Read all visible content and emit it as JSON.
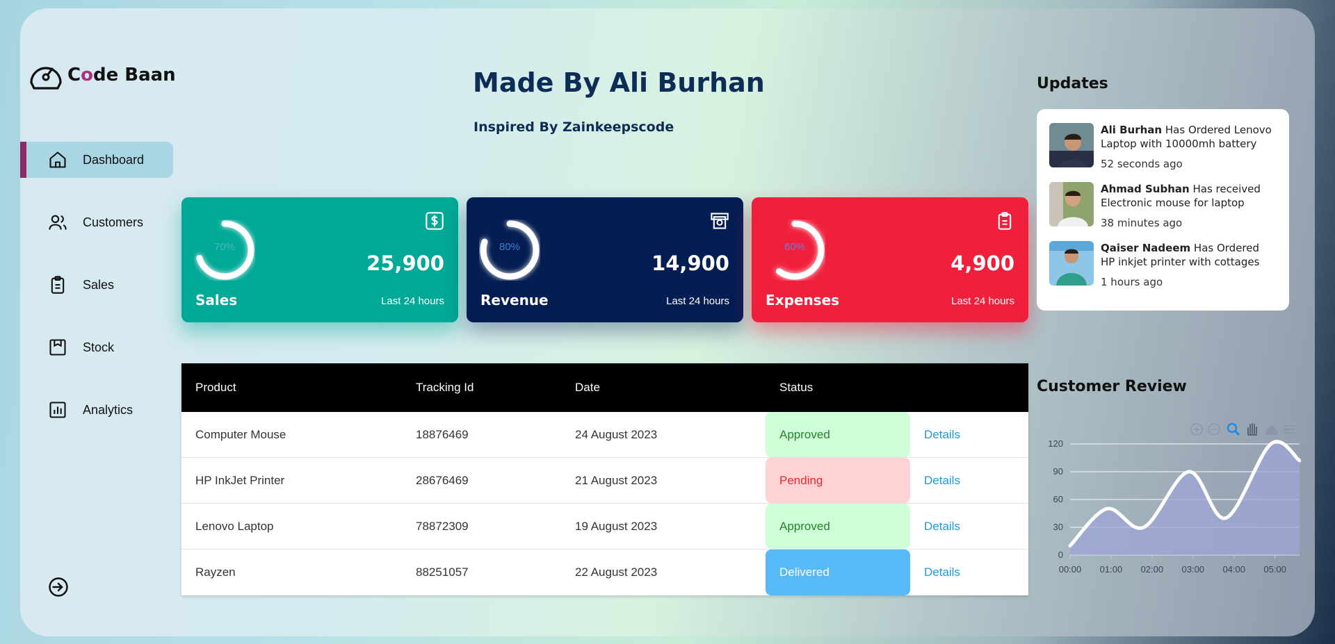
{
  "brand": {
    "prefix": "C",
    "accent": "o",
    "rest": "de Baan"
  },
  "sidebar": {
    "items": [
      {
        "label": "Dashboard",
        "icon": "home-icon",
        "active": true
      },
      {
        "label": "Customers",
        "icon": "users-icon",
        "active": false
      },
      {
        "label": "Sales",
        "icon": "clipboard-icon",
        "active": false
      },
      {
        "label": "Stock",
        "icon": "package-icon",
        "active": false
      },
      {
        "label": "Analytics",
        "icon": "bar-chart-icon",
        "active": false
      }
    ],
    "logout_icon": "logout-icon"
  },
  "header": {
    "title": "Made By Ali Burhan",
    "subtitle": "Inspired By Zainkeepscode"
  },
  "cards": [
    {
      "name": "Sales",
      "value": "25,900",
      "percent": "70%",
      "progress": 70,
      "time": "Last 24 hours",
      "icon": "dollar-icon",
      "color": "#00a896"
    },
    {
      "name": "Revenue",
      "value": "14,900",
      "percent": "80%",
      "progress": 80,
      "time": "Last 24 hours",
      "icon": "money-icon",
      "color": "#041d52"
    },
    {
      "name": "Expenses",
      "value": "4,900",
      "percent": "60%",
      "progress": 60,
      "time": "Last 24 hours",
      "icon": "clipboard-icon",
      "color": "#f0203d"
    }
  ],
  "table": {
    "headers": [
      "Product",
      "Tracking Id",
      "Date",
      "Status"
    ],
    "rows": [
      {
        "product": "Computer Mouse",
        "tracking": "18876469",
        "date": "24 August 2023",
        "status": "Approved",
        "action": "Details"
      },
      {
        "product": "HP InkJet Printer",
        "tracking": "28676469",
        "date": "21 August 2023",
        "status": "Pending",
        "action": "Details"
      },
      {
        "product": "Lenovo Laptop",
        "tracking": "78872309",
        "date": "19 August 2023",
        "status": "Approved",
        "action": "Details"
      },
      {
        "product": "Rayzen",
        "tracking": "88251057",
        "date": "22 August 2023",
        "status": "Delivered",
        "action": "Details"
      }
    ]
  },
  "updates": {
    "title": "Updates",
    "items": [
      {
        "name": "Ali Burhan",
        "text": "Has Ordered Lenovo Laptop with 10000mh battery",
        "time": "52 seconds ago"
      },
      {
        "name": "Ahmad Subhan",
        "text": "Has received Electronic mouse for laptop",
        "time": "38 minutes ago"
      },
      {
        "name": "Qaiser Nadeem",
        "text": "Has Ordered HP inkjet printer with cottages",
        "time": "1 hours ago"
      }
    ]
  },
  "review": {
    "title": "Customer Review",
    "toolbar_icons": [
      "zoom-in-icon",
      "zoom-out-icon",
      "zoom-select-icon",
      "pan-hand-icon",
      "reset-home-icon",
      "menu-icon"
    ]
  },
  "chart_data": {
    "type": "area",
    "x": [
      "00:00",
      "01:00",
      "02:00",
      "03:00",
      "04:00",
      "05:00"
    ],
    "y_ticks": [
      0,
      30,
      60,
      90,
      120
    ],
    "ylim": [
      0,
      120
    ],
    "points": [
      [
        0,
        10
      ],
      [
        0.9,
        50
      ],
      [
        1.8,
        30
      ],
      [
        2.9,
        90
      ],
      [
        3.8,
        40
      ],
      [
        4.9,
        120
      ],
      [
        5.6,
        102
      ]
    ],
    "fill": "#9ea6d6",
    "line": "#ffffff"
  }
}
